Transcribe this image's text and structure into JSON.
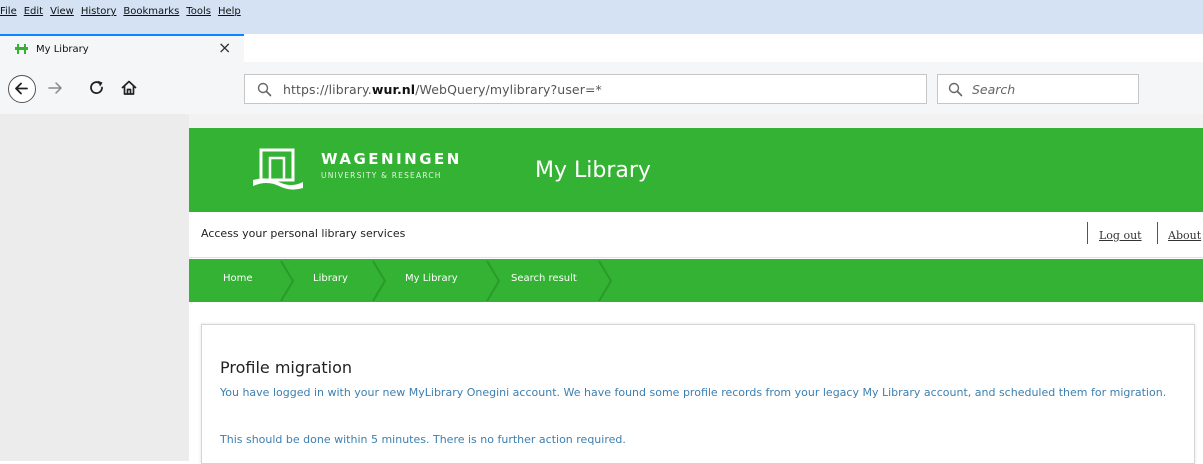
{
  "menubar": {
    "items": [
      "File",
      "Edit",
      "View",
      "History",
      "Bookmarks",
      "Tools",
      "Help"
    ]
  },
  "tab": {
    "title": "My Library",
    "close": "×",
    "new_tab": "+"
  },
  "address": {
    "url_prefix": "https://library.",
    "url_domain": "wur.nl",
    "url_suffix": "/WebQuery/mylibrary?user=*"
  },
  "search": {
    "placeholder": "Search"
  },
  "header": {
    "logo_name": "WAGENINGEN",
    "logo_sub": "UNIVERSITY & RESEARCH",
    "title": "My Library"
  },
  "subheader": {
    "tagline": "Access your personal library services",
    "logout": "Log out",
    "about": "About"
  },
  "breadcrumb": [
    "Home",
    "Library",
    "My Library",
    "Search result"
  ],
  "panel": {
    "title": "Profile migration",
    "message1": "You have logged in with your new MyLibrary Onegini account. We have found some profile records from your legacy My Library account, and scheduled them for migration.",
    "message2": "This should be done within 5 minutes. There is no further action required."
  },
  "colors": {
    "brand_green": "#34b233",
    "link_blue": "#3c7fb0",
    "menubar_bg": "#d4e2f3"
  }
}
